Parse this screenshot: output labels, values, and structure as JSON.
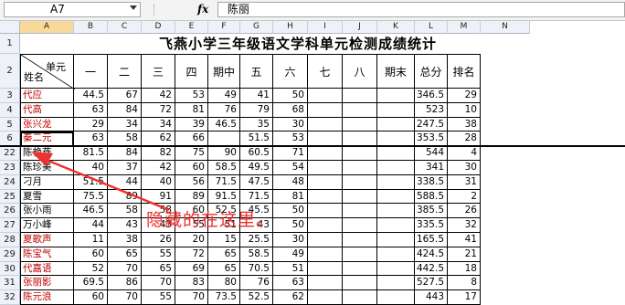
{
  "formula_bar": {
    "name_box": "A7",
    "fx_label": "fx",
    "formula_value": "陈丽"
  },
  "columns": [
    "A",
    "B",
    "C",
    "D",
    "E",
    "F",
    "G",
    "H",
    "I",
    "J",
    "K",
    "L",
    "M",
    "N"
  ],
  "sheet": {
    "title": "飞燕小学三年级语文学科单元检测成绩统计",
    "header_corner_top": "单元",
    "header_corner_bottom": "姓名",
    "headers": [
      "一",
      "二",
      "三",
      "四",
      "期中",
      "五",
      "六",
      "七",
      "八",
      "期末",
      "总分",
      "排名"
    ],
    "rows": [
      {
        "row": "3",
        "name": "代应",
        "red": true,
        "vals": [
          "44.5",
          "67",
          "42",
          "53",
          "49",
          "41",
          "50",
          "",
          "",
          "",
          "346.5",
          "29"
        ]
      },
      {
        "row": "4",
        "name": "代高",
        "red": true,
        "vals": [
          "63",
          "84",
          "72",
          "81",
          "76",
          "79",
          "68",
          "",
          "",
          "",
          "523",
          "10"
        ]
      },
      {
        "row": "5",
        "name": "张兴龙",
        "red": true,
        "vals": [
          "29",
          "34",
          "34",
          "39",
          "46.5",
          "35",
          "30",
          "",
          "",
          "",
          "247.5",
          "38"
        ]
      },
      {
        "row": "6",
        "name": "秦二元",
        "red": true,
        "vals": [
          "63",
          "58",
          "62",
          "66",
          "",
          "51.5",
          "53",
          "",
          "",
          "",
          "353.5",
          "28"
        ]
      },
      {
        "row": "22",
        "name": "陈艳燕",
        "red": false,
        "vals": [
          "81.5",
          "84",
          "82",
          "75",
          "90",
          "60.5",
          "71",
          "",
          "",
          "",
          "544",
          "4"
        ]
      },
      {
        "row": "23",
        "name": "陈珍美",
        "red": false,
        "vals": [
          "40",
          "37",
          "42",
          "60",
          "58.5",
          "49.5",
          "54",
          "",
          "",
          "",
          "341",
          "30"
        ]
      },
      {
        "row": "24",
        "name": "刁月",
        "red": false,
        "vals": [
          "51.5",
          "44",
          "40",
          "56",
          "71.5",
          "47.5",
          "48",
          "",
          "",
          "",
          "338.5",
          "31"
        ]
      },
      {
        "row": "25",
        "name": "夏雪",
        "red": false,
        "vals": [
          "75.5",
          "89",
          "91",
          "89",
          "91.5",
          "71.5",
          "81",
          "",
          "",
          "",
          "588.5",
          "2"
        ]
      },
      {
        "row": "26",
        "name": "张小雨",
        "red": false,
        "vals": [
          "46.5",
          "58",
          "58",
          "60",
          "52.5",
          "45.5",
          "50",
          "",
          "",
          "",
          "385.5",
          "26"
        ]
      },
      {
        "row": "27",
        "name": "万小峰",
        "red": false,
        "vals": [
          "44",
          "43",
          "43",
          "55",
          "51",
          "43",
          "50",
          "",
          "",
          "",
          "335.5",
          "32"
        ]
      },
      {
        "row": "28",
        "name": "夏歌声",
        "red": true,
        "vals": [
          "11",
          "38",
          "26",
          "20",
          "15",
          "25.5",
          "30",
          "",
          "",
          "",
          "165.5",
          "41"
        ]
      },
      {
        "row": "29",
        "name": "陈宝气",
        "red": true,
        "vals": [
          "60",
          "65",
          "55",
          "72",
          "65",
          "58.5",
          "49",
          "",
          "",
          "",
          "424.5",
          "21"
        ]
      },
      {
        "row": "30",
        "name": "代嘉语",
        "red": true,
        "vals": [
          "52",
          "70",
          "65",
          "69",
          "65",
          "70.5",
          "51",
          "",
          "",
          "",
          "442.5",
          "18"
        ]
      },
      {
        "row": "31",
        "name": "张丽影",
        "red": true,
        "vals": [
          "69.5",
          "86",
          "70",
          "83",
          "80",
          "76",
          "63",
          "",
          "",
          "",
          "527.5",
          "8"
        ]
      },
      {
        "row": "32",
        "name": "陈元浪",
        "red": true,
        "vals": [
          "60",
          "70",
          "55",
          "70",
          "73.5",
          "52.5",
          "62",
          "",
          "",
          "",
          "443",
          "17"
        ]
      }
    ]
  },
  "annotation": "隐藏的在这里。",
  "colors": {
    "red_text": "#c00000",
    "annotation": "#f03030",
    "arrow": "#f03030"
  }
}
